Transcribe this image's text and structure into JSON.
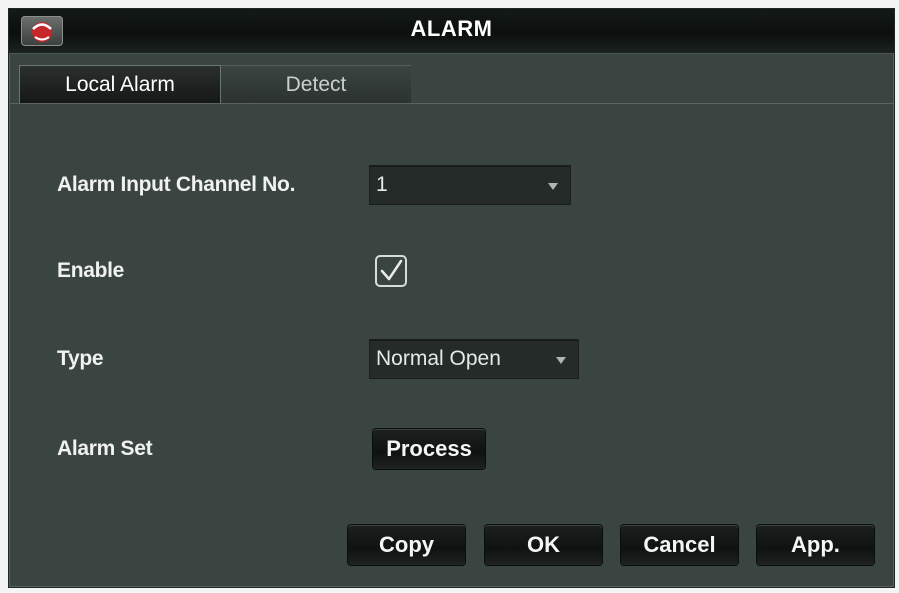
{
  "window": {
    "title": "ALARM"
  },
  "tabs": [
    {
      "label": "Local Alarm",
      "selected": true
    },
    {
      "label": "Detect",
      "selected": false
    }
  ],
  "form": {
    "channel": {
      "label": "Alarm Input Channel No.",
      "value": "1"
    },
    "enable": {
      "label": "Enable",
      "checked": true
    },
    "type": {
      "label": "Type",
      "value": "Normal Open"
    },
    "alarm_set": {
      "label": "Alarm Set",
      "button_label": "Process"
    }
  },
  "buttons": {
    "copy": "Copy",
    "ok": "OK",
    "cancel": "Cancel",
    "apply": "App."
  },
  "icons": {
    "app": "app-logo-icon",
    "dropdown": "chevron-down-icon",
    "check": "checkbox-checked-icon"
  },
  "colors": {
    "panel_bg": "#3a4441",
    "titlebar_bg": "#0b0f0e",
    "button_bg": "#0e1211",
    "text": "#ffffff"
  }
}
